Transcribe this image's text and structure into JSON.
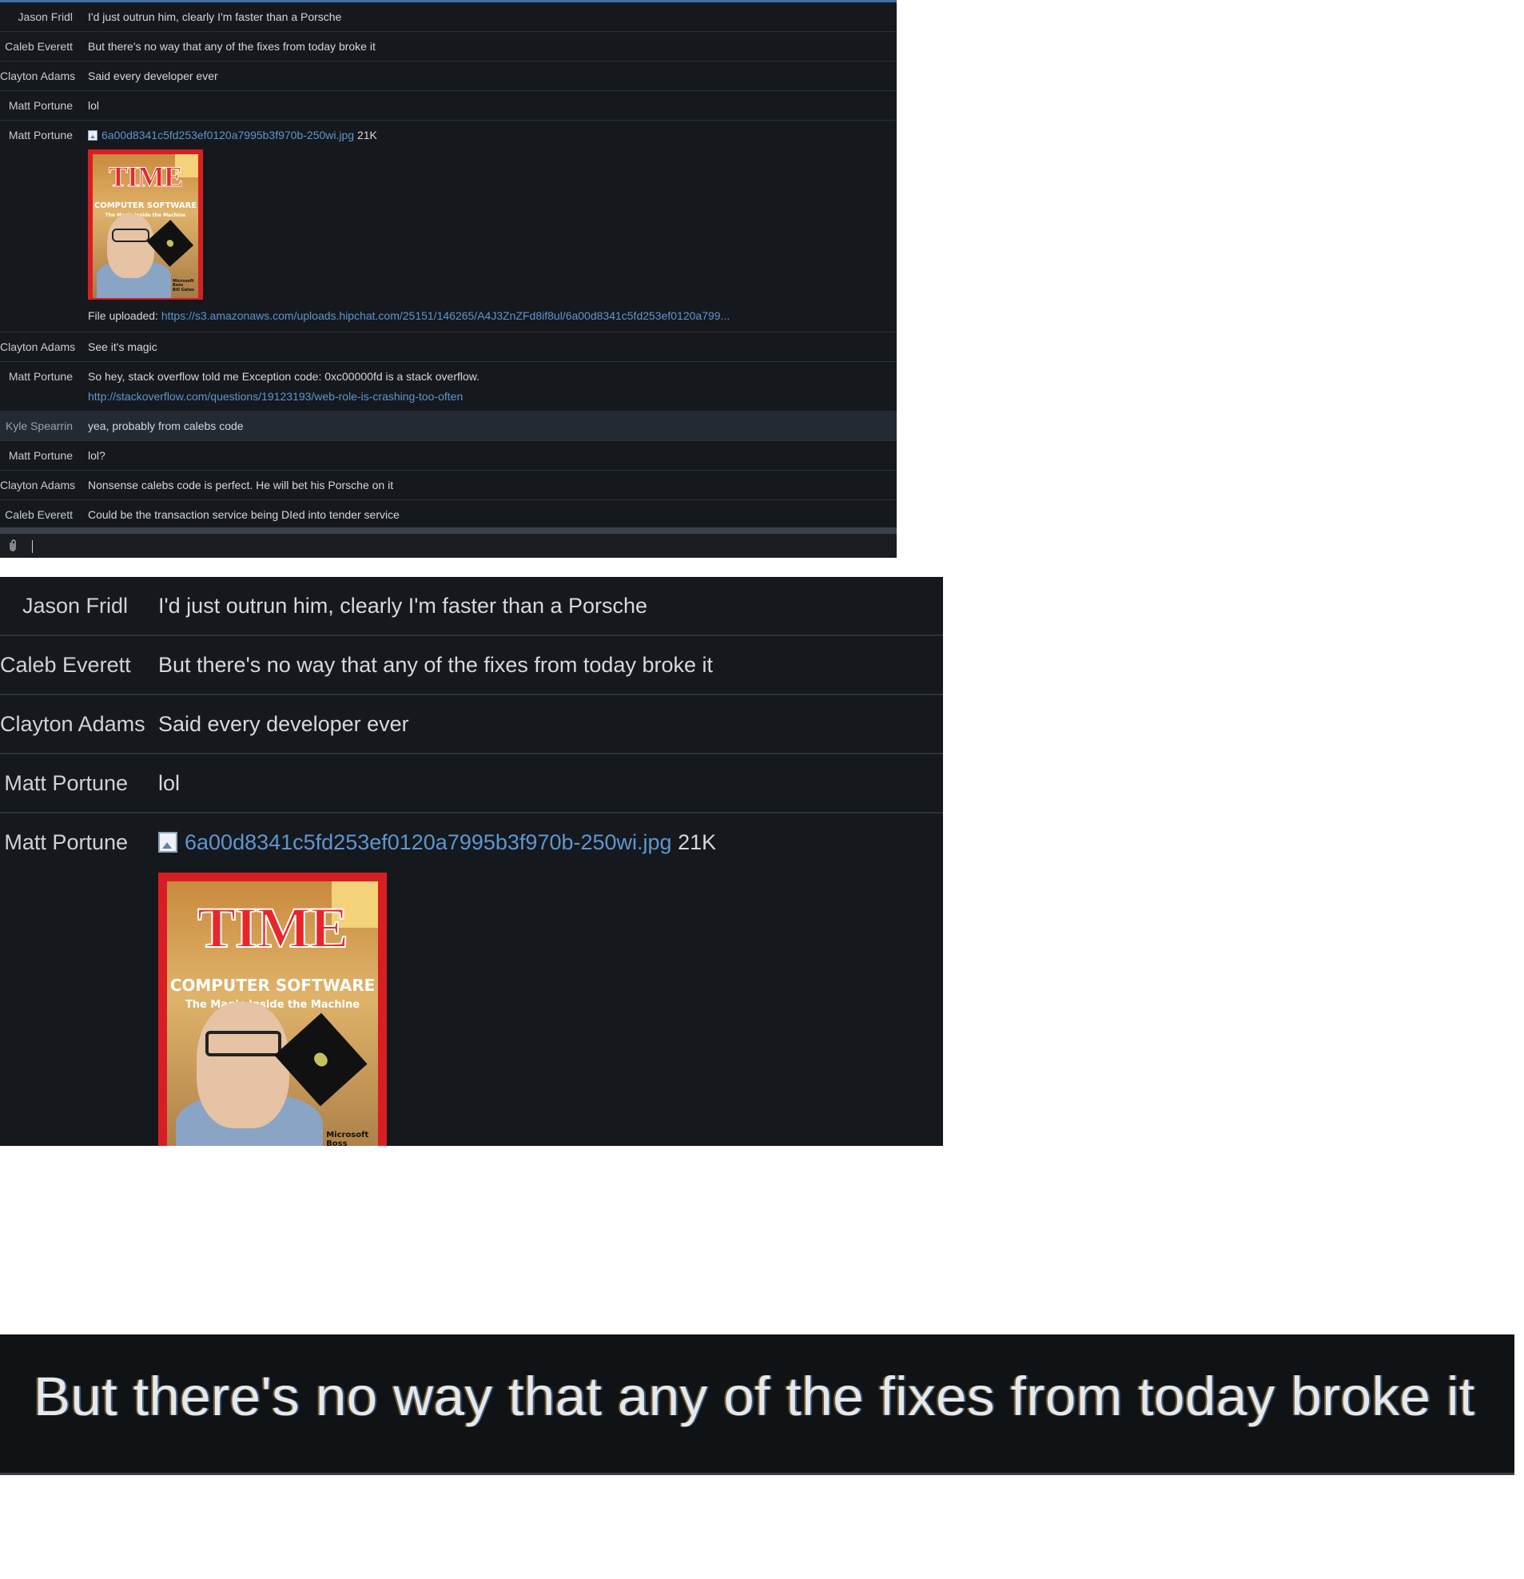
{
  "chat": {
    "messages": [
      {
        "author": "Jason Fridl",
        "text": "I'd just outrun him, clearly I'm faster than a Porsche"
      },
      {
        "author": "Caleb Everett",
        "text": "But there's no way that any of the fixes from today broke it"
      },
      {
        "author": "Clayton Adams",
        "text": "Said every developer ever"
      },
      {
        "author": "Matt Portune",
        "text": "lol"
      },
      {
        "author": "Matt Portune",
        "file_name": "6a00d8341c5fd253ef0120a7995b3f970b-250wi.jpg",
        "file_size": "21K",
        "image_icon": "image-file-icon",
        "uploaded_label": "File uploaded:",
        "uploaded_url": "https://s3.amazonaws.com/uploads.hipchat.com/25151/146265/A4J3ZnZFd8if8ul/6a00d8341c5fd253ef0120a799..."
      },
      {
        "author": "Clayton Adams",
        "text": "See it's magic"
      },
      {
        "author": "Matt Portune",
        "text": "So hey, stack overflow told me Exception code: 0xc00000fd is a stack overflow.",
        "link": "http://stackoverflow.com/questions/19123193/web-role-is-crashing-too-often"
      },
      {
        "author": "Kyle Spearrin",
        "text": "yea, probably from calebs code"
      },
      {
        "author": "Matt Portune",
        "text": "lol?"
      },
      {
        "author": "Clayton Adams",
        "text": "Nonsense calebs code is perfect. He will bet his Porsche on it"
      },
      {
        "author": "Caleb Everett",
        "text": "Could be the transaction service being DIed into tender service"
      }
    ],
    "attach_icon": "paperclip-icon"
  },
  "cover": {
    "masthead": "TIME",
    "headline": "COMPUTER SOFTWARE",
    "subheadline": "The Magic Inside the Machine",
    "tag_line1": "Microsoft",
    "tag_line2": "Boss",
    "tag_line3": "Bill Gates"
  },
  "zoom": {
    "big_text": "But there's no way that any of the fixes from today broke it"
  },
  "colors": {
    "background": "#15181d",
    "link": "#5e96d0",
    "accent": "#3f6ea8"
  }
}
